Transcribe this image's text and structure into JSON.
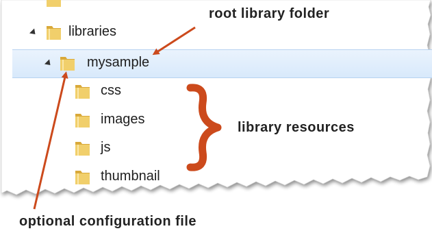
{
  "tree": {
    "items": [
      {
        "label": "libraries",
        "depth": 0,
        "expanded": true
      },
      {
        "label": "mysample",
        "depth": 1,
        "expanded": true,
        "selected": true
      },
      {
        "label": "css",
        "depth": 2
      },
      {
        "label": "images",
        "depth": 2
      },
      {
        "label": "js",
        "depth": 2
      },
      {
        "label": "thumbnail",
        "depth": 2
      }
    ]
  },
  "annotations": {
    "root_library_folder": "root library folder",
    "library_resources": "library resources",
    "optional_configuration_file": "optional configuration file"
  },
  "colors": {
    "selection_fill": "#dbeafc",
    "selection_border": "#b6d2f0",
    "arrow": "#cc4a1c",
    "brace": "#cc4a1c",
    "folder": "#e9c15a"
  },
  "icons": {
    "folder": "folder-icon",
    "expanded_twisty": "expanded-triangle-icon"
  }
}
